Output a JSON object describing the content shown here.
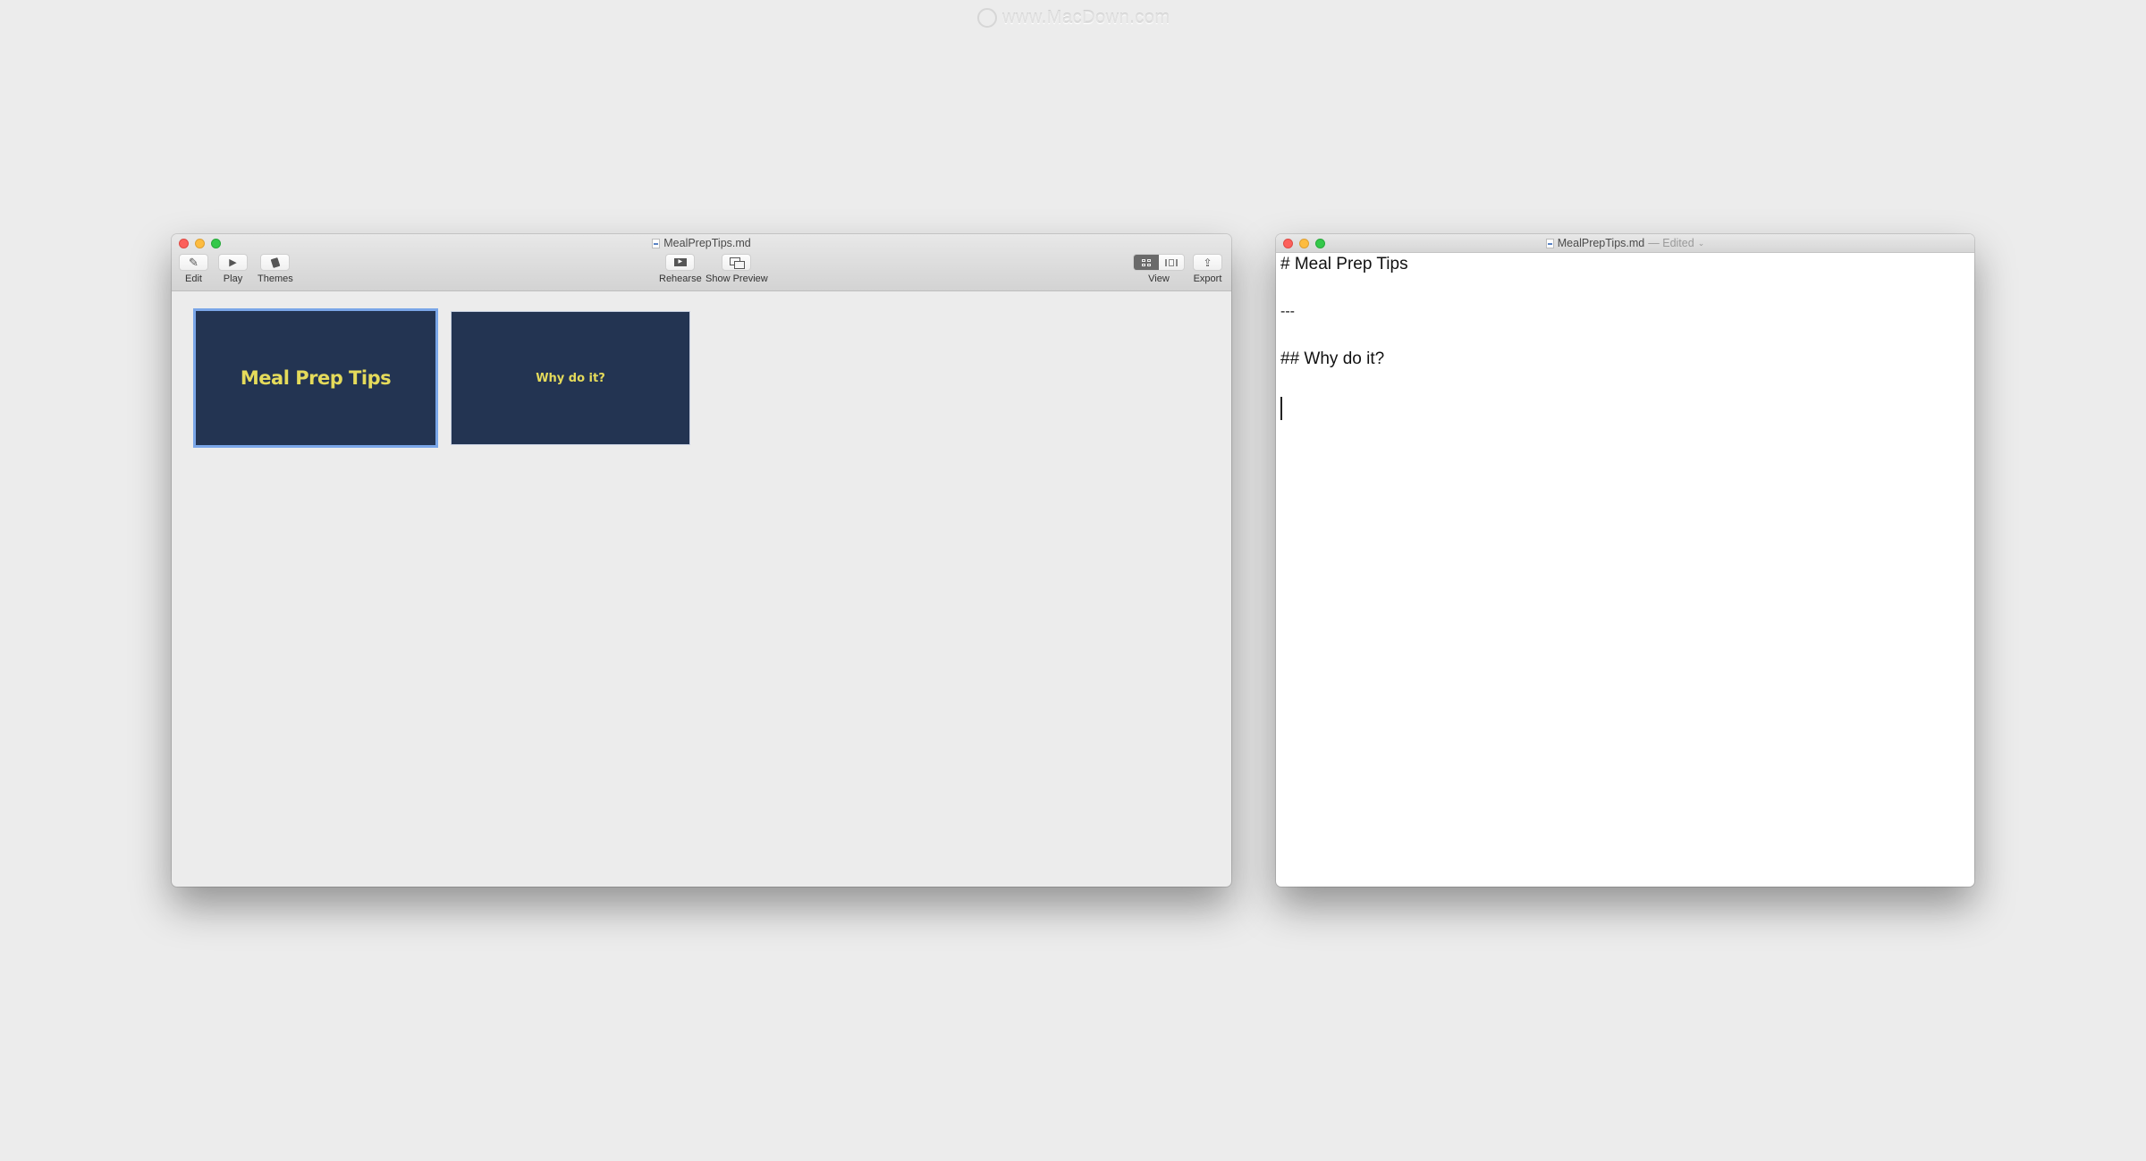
{
  "watermark": {
    "text": "www.MacDown.com"
  },
  "preview_window": {
    "title": "MealPrepTips.md",
    "toolbar": {
      "left": [
        {
          "label": "Edit",
          "icon": "pencil-icon"
        },
        {
          "label": "Play",
          "icon": "play-icon"
        },
        {
          "label": "Themes",
          "icon": "themes-icon"
        }
      ],
      "center": [
        {
          "label": "Rehearse",
          "icon": "rehearse-icon"
        },
        {
          "label": "Show Preview",
          "icon": "show-preview-icon"
        }
      ],
      "view": {
        "label": "View",
        "options": [
          "grid",
          "slide"
        ],
        "selected": "grid"
      },
      "export": {
        "label": "Export",
        "icon": "share-icon"
      }
    },
    "slides": [
      {
        "title": "Meal Prep Tips",
        "selected": true
      },
      {
        "title": "Why do it?",
        "selected": false
      }
    ],
    "colors": {
      "slide_bg": "#233452",
      "slide_text": "#e5db5b",
      "selection": "#7aa6e8"
    }
  },
  "editor_window": {
    "title": "MealPrepTips.md",
    "status": "— Edited",
    "lines": [
      "# Meal Prep Tips",
      "",
      "---",
      "",
      "## Why do it?",
      ""
    ]
  }
}
